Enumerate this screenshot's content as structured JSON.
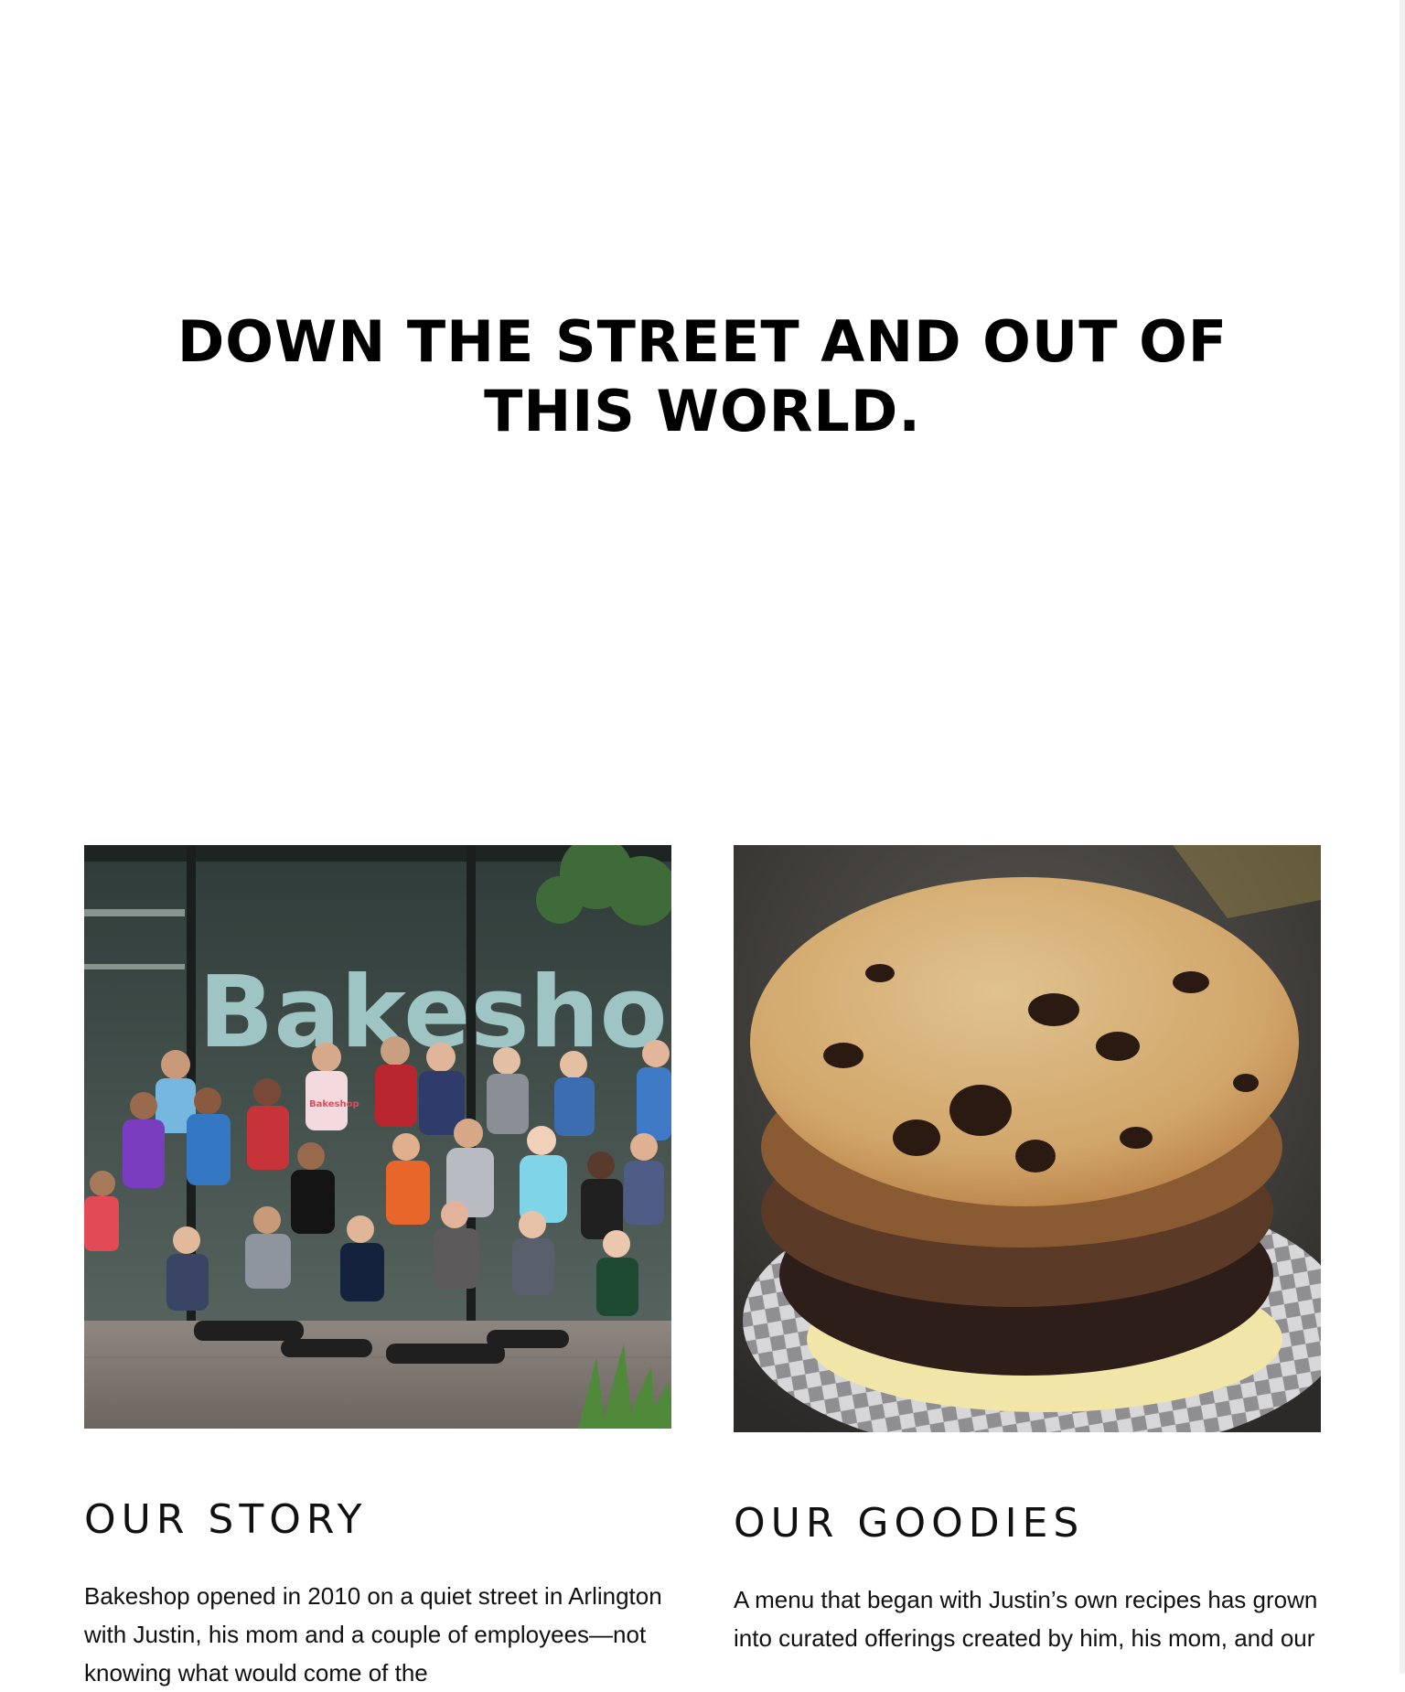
{
  "hero": {
    "title": "DOWN THE STREET AND OUT OF THIS WORLD."
  },
  "story": {
    "photo_sign_text": "Bakeshop",
    "shirt_text": "Bakeshop",
    "heading": "OUR STORY",
    "body": "Bakeshop opened in 2010 on a quiet street in Arlington with Justin, his mom and a couple of employees—not knowing what would come of the"
  },
  "goodies": {
    "heading": "OUR GOODIES",
    "body": "A menu that began with Justin’s own recipes has grown into curated offerings created by him, his mom, and our"
  },
  "colors": {
    "text": "#111111",
    "background": "#ffffff",
    "storefront_window": "#3a4a48",
    "sign_letters": "#a9d3d2",
    "cookie_top": "#d2a86b",
    "cookie_molasses": "#8a5a33",
    "cookie_chocolate": "#2e1e1a"
  }
}
